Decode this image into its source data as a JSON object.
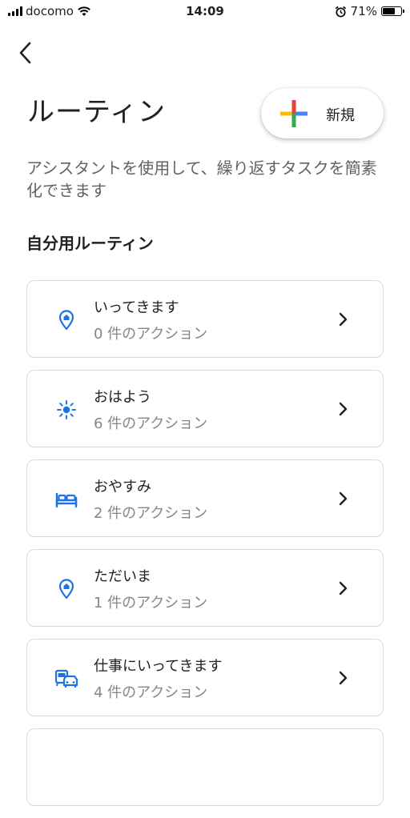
{
  "status_bar": {
    "carrier": "docomo",
    "time": "14:09",
    "battery_percent": "71%",
    "battery_level": 0.71,
    "icons": [
      "signal-icon",
      "wifi-icon",
      "alarm-icon",
      "battery-icon"
    ]
  },
  "header": {
    "back_icon": "back-arrow-icon",
    "title": "ルーティン",
    "new_button_label": "新規",
    "new_button_icon": "plus-icon"
  },
  "description": "アシスタントを使用して、繰り返すタスクを簡素化できます",
  "section": {
    "title": "自分用ルーティン"
  },
  "routines": [
    {
      "name": "いってきます",
      "count": "0 件のアクション",
      "icon": "location-home-icon"
    },
    {
      "name": "おはよう",
      "count": "6 件のアクション",
      "icon": "sun-icon"
    },
    {
      "name": "おやすみ",
      "count": "2 件のアクション",
      "icon": "bed-icon"
    },
    {
      "name": "ただいま",
      "count": "1 件のアクション",
      "icon": "location-home-icon"
    },
    {
      "name": "仕事にいってきます",
      "count": "4 件のアクション",
      "icon": "commute-icon"
    }
  ],
  "colors": {
    "icon_blue": "#1a73e8",
    "google_blue": "#4285F4",
    "google_red": "#EA4335",
    "google_yellow": "#FBBC05",
    "google_green": "#34A853",
    "secondary_text": "#80868b"
  }
}
